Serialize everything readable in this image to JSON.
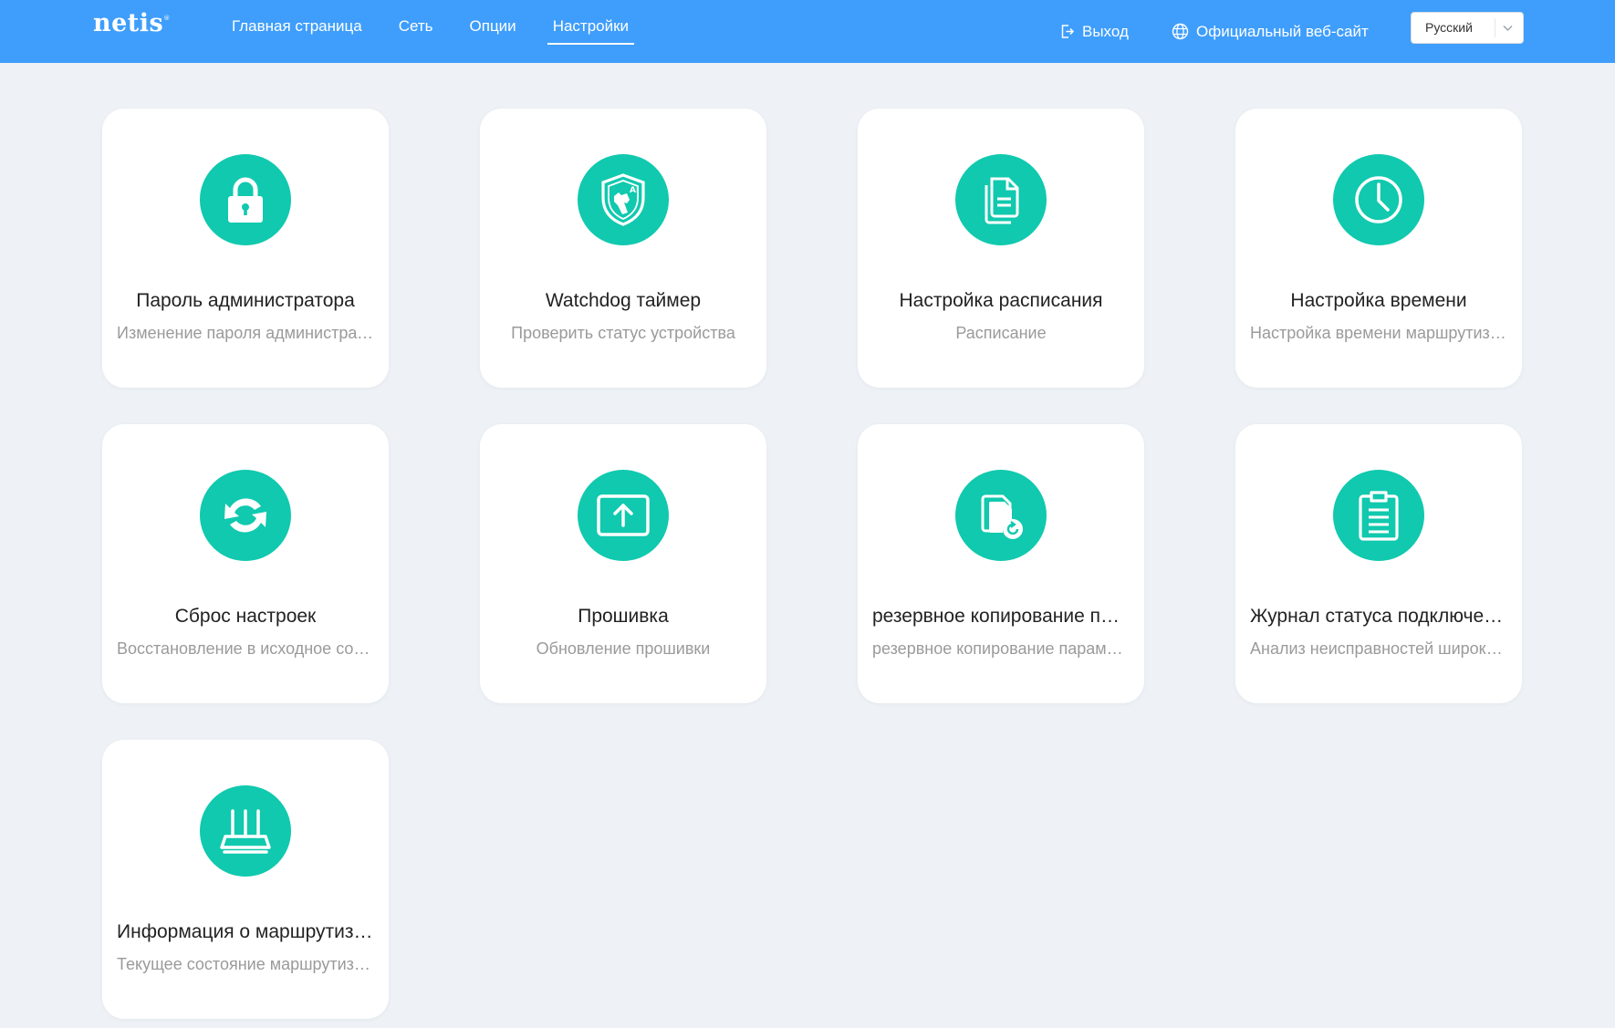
{
  "brand": {
    "logo": "netis",
    "logo_mark": "®"
  },
  "nav": {
    "items": [
      {
        "label": "Главная страница",
        "active": false
      },
      {
        "label": "Сеть",
        "active": false
      },
      {
        "label": "Опции",
        "active": false
      },
      {
        "label": "Настройки",
        "active": true
      }
    ]
  },
  "header": {
    "logout_label": "Выход",
    "website_label": "Официальный веб-сайт",
    "language": "Русский"
  },
  "colors": {
    "topbar": "#3f9efb",
    "accent": "#10c9ae",
    "background": "#eef2f6"
  },
  "cards": [
    {
      "icon": "lock-icon",
      "title": "Пароль администратора",
      "subtitle": "Изменение пароля администратора"
    },
    {
      "icon": "watchdog-shield-icon",
      "title": "Watchdog таймер",
      "subtitle": "Проверить статус устройства"
    },
    {
      "icon": "schedule-document-icon",
      "title": "Настройка расписания",
      "subtitle": "Расписание"
    },
    {
      "icon": "clock-icon",
      "title": "Настройка времени",
      "subtitle": "Настройка времени маршрутизатора"
    },
    {
      "icon": "reset-arrows-icon",
      "title": "Сброс настроек",
      "subtitle": "Восстановление в исходное состояние"
    },
    {
      "icon": "firmware-upload-icon",
      "title": "Прошивка",
      "subtitle": "Обновление прошивки"
    },
    {
      "icon": "backup-files-icon",
      "title": "резервное копирование параметров",
      "subtitle": "резервное копирование параметров"
    },
    {
      "icon": "clipboard-log-icon",
      "title": "Журнал статуса подключения",
      "subtitle": "Анализ неисправностей широкополосного доступа"
    },
    {
      "icon": "router-icon",
      "title": "Информация о маршрутизаторе",
      "subtitle": "Текущее состояние маршрутизатора"
    }
  ]
}
